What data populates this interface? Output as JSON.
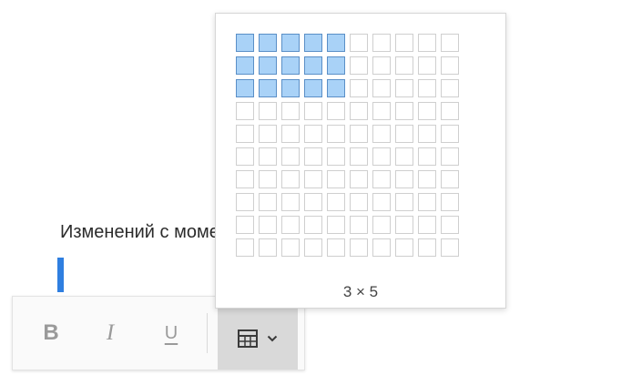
{
  "document": {
    "text": "Изменений с момента последнего характера"
  },
  "toolbar": {
    "bold_label": "B",
    "italic_label": "I",
    "underline_label": "U",
    "table_icon": "table-icon",
    "dropdown_icon": "chevron-down-icon"
  },
  "table_picker": {
    "rows": 10,
    "columns": 10,
    "selected_rows": 3,
    "selected_columns": 5,
    "size_label": "3 × 5"
  },
  "colors": {
    "caret": "#2f7fe0",
    "selected_cell": "#a9d2f7",
    "selected_border": "#5a8fc7",
    "cell_border": "#cfcfcf"
  }
}
